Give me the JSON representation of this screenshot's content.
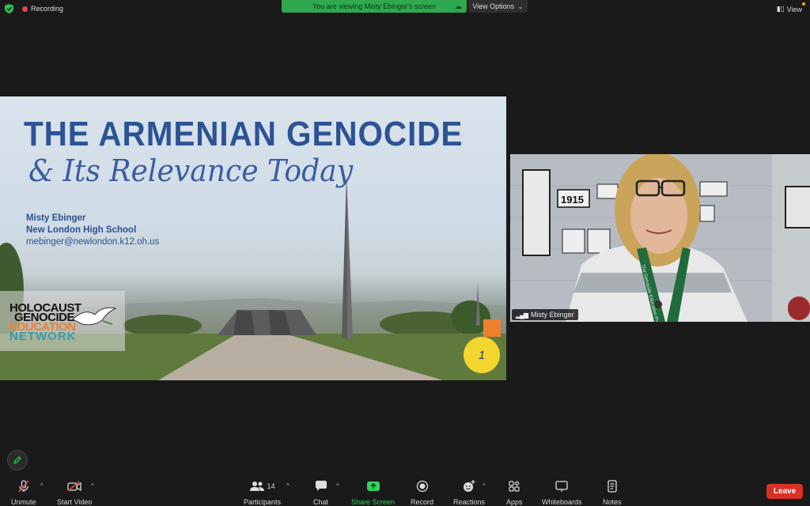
{
  "topbar": {
    "recording_label": "Recording",
    "viewing_label": "You are viewing Misty Ebinger's screen",
    "view_options_label": "View Options",
    "view_label": "View"
  },
  "slide": {
    "title_line1": "THE ARMENIAN GENOCIDE",
    "title_line2": "& Its Relevance Today",
    "presenter_name": "Misty Ebinger",
    "presenter_school": "New London High School",
    "presenter_email": "mebinger@newlondon.k12.oh.us",
    "logo_line1": "HOLOCAUST",
    "logo_line2": "GENOCIDE",
    "logo_line3": "EDUCATION",
    "logo_line4": "NETWORK",
    "page_number": "1",
    "colors": {
      "title": "#2d5394",
      "logo_orange": "#ee7f2f",
      "logo_teal": "#3a9aa8"
    }
  },
  "video": {
    "participant_name": "Misty Ebinger",
    "poster_text": "1915",
    "lanyard_text": "The Genocide Education Project"
  },
  "toolbar": {
    "unmute": "Unmute",
    "start_video": "Start Video",
    "participants": "Participants",
    "participants_count": "14",
    "chat": "Chat",
    "share_screen": "Share Screen",
    "record": "Record",
    "reactions": "Reactions",
    "apps": "Apps",
    "whiteboards": "Whiteboards",
    "notes": "Notes",
    "leave": "Leave",
    "colors": {
      "leave": "#d93025",
      "share": "#2fd45b"
    }
  }
}
